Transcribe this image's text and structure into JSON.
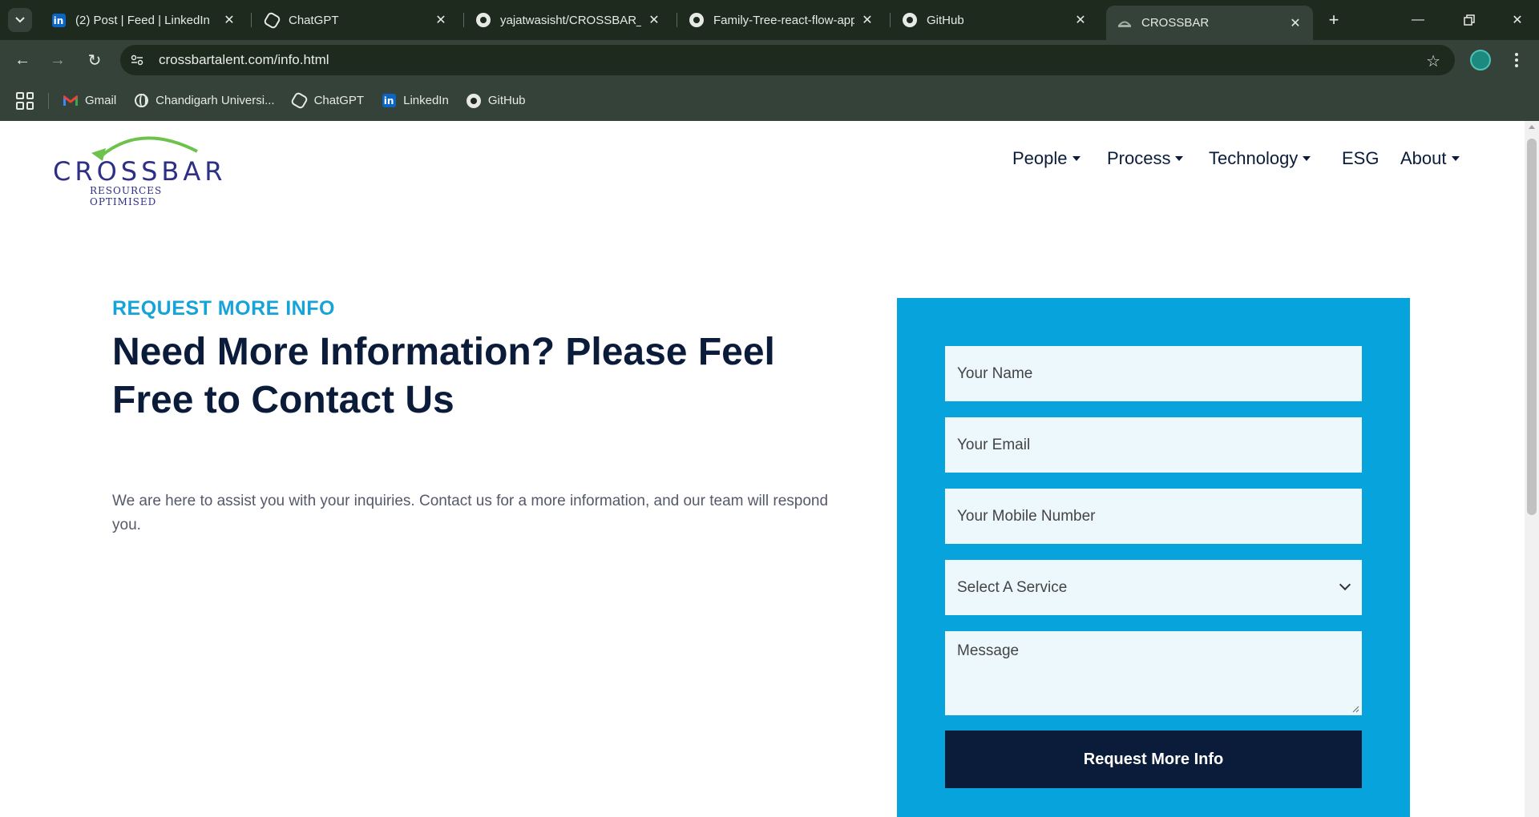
{
  "browser": {
    "tabs": [
      {
        "title": "(2) Post | Feed | LinkedIn",
        "icon": "linkedin-icon"
      },
      {
        "title": "ChatGPT",
        "icon": "chatgpt-icon"
      },
      {
        "title": "yajatwasisht/CROSSBAR_W",
        "icon": "github-icon"
      },
      {
        "title": "Family-Tree-react-flow-app",
        "icon": "github-icon"
      },
      {
        "title": "GitHub",
        "icon": "github-icon"
      },
      {
        "title": "CROSSBAR",
        "icon": "crossbar-icon",
        "active": true
      }
    ],
    "url": "crossbartalent.com/info.html",
    "bookmarks": [
      {
        "label": "Gmail",
        "icon": "gmail-icon"
      },
      {
        "label": "Chandigarh Universi...",
        "icon": "globe-icon"
      },
      {
        "label": "ChatGPT",
        "icon": "chatgpt-icon"
      },
      {
        "label": "LinkedIn",
        "icon": "linkedin-icon"
      },
      {
        "label": "GitHub",
        "icon": "github-icon"
      }
    ]
  },
  "site": {
    "logo": {
      "name": "CROSSBAR",
      "tagline": "RESOURCES OPTIMISED"
    },
    "nav": [
      {
        "label": "People",
        "dropdown": true
      },
      {
        "label": "Process",
        "dropdown": true
      },
      {
        "label": "Technology",
        "dropdown": true
      },
      {
        "label": "ESG",
        "dropdown": false
      },
      {
        "label": "About",
        "dropdown": true
      }
    ]
  },
  "hero": {
    "eyebrow": "REQUEST MORE INFO",
    "headline": "Need More Information? Please Feel Free to Contact Us",
    "intro": "We are here to assist you with your inquiries. Contact us for a more information, and our team will respond you."
  },
  "form": {
    "name_placeholder": "Your Name",
    "email_placeholder": "Your Email",
    "mobile_placeholder": "Your Mobile Number",
    "service_selected": "Select A Service",
    "message_placeholder": "Message",
    "submit_label": "Request More Info"
  },
  "colors": {
    "accent": "#16a3d8",
    "form_bg": "#06a3dc",
    "navy": "#0b1c3a",
    "chrome_bg": "#243024"
  }
}
